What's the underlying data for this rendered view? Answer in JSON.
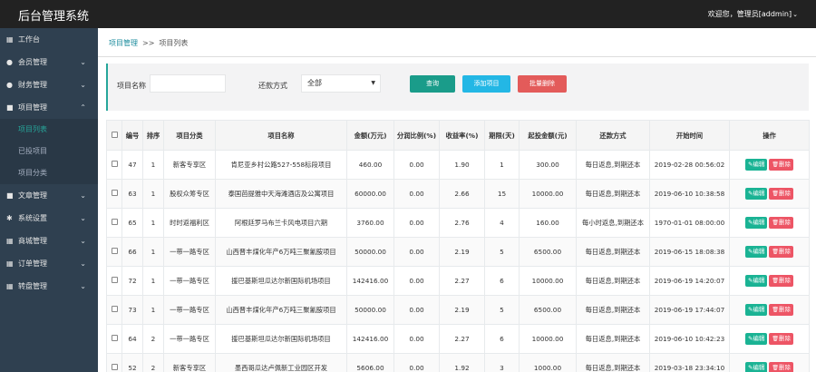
{
  "app": {
    "title": "后台管理系统",
    "user": "欢迎您，管理员[addmin]"
  },
  "sidebar": {
    "items": [
      {
        "label": "工作台",
        "icon": "grid-icon",
        "glyph": "▦",
        "chev": ""
      },
      {
        "label": "会员管理",
        "icon": "user-icon",
        "glyph": "●",
        "chev": "⌄"
      },
      {
        "label": "财务管理",
        "icon": "dollar-icon",
        "glyph": "●",
        "chev": "⌄"
      },
      {
        "label": "项目管理",
        "icon": "list-icon",
        "glyph": "■",
        "chev": "⌃"
      }
    ],
    "sub_items": [
      {
        "label": "项目列表",
        "active": true
      },
      {
        "label": "已投项目",
        "active": false
      },
      {
        "label": "项目分类",
        "active": false
      }
    ],
    "items_after": [
      {
        "label": "文章管理",
        "icon": "file-icon",
        "glyph": "■",
        "chev": "⌄"
      },
      {
        "label": "系统设置",
        "icon": "gear-icon",
        "glyph": "✱",
        "chev": "⌄"
      },
      {
        "label": "商城管理",
        "icon": "grid-icon",
        "glyph": "▦",
        "chev": "⌄"
      },
      {
        "label": "订单管理",
        "icon": "grid-icon",
        "glyph": "▦",
        "chev": "⌄"
      },
      {
        "label": "转盘管理",
        "icon": "grid-icon",
        "glyph": "▦",
        "chev": "⌄"
      }
    ]
  },
  "breadcrumb": {
    "parent": "项目管理",
    "separator": ">>",
    "current": "项目列表"
  },
  "filter": {
    "name_label": "项目名称",
    "name_value": "",
    "repay_label": "还款方式",
    "repay_value": "全部",
    "search_btn": "查询",
    "add_btn": "添加项目",
    "batch_delete_btn": "批量删除"
  },
  "table": {
    "headers": [
      "",
      "编号",
      "排序",
      "项目分类",
      "项目名称",
      "金额(万元)",
      "分润比例(%)",
      "收益率(%)",
      "期限(天)",
      "起投金额(元)",
      "还款方式",
      "开始时间",
      "操作"
    ],
    "edit_label": "编辑",
    "delete_label": "删除",
    "rows": [
      {
        "id": "47",
        "sort": "1",
        "category": "新客专享区",
        "name": "肯尼亚乡村公路527-558标段项目",
        "amount": "460.00",
        "share": "0.00",
        "rate": "1.90",
        "term": "1",
        "min": "300.00",
        "repay": "每日返息,到期还本",
        "start": "2019-02-28 00:56:02"
      },
      {
        "id": "63",
        "sort": "1",
        "category": "股权众筹专区",
        "name": "泰国芭提雅中天海滩酒店及公寓项目",
        "amount": "60000.00",
        "share": "0.00",
        "rate": "2.66",
        "term": "15",
        "min": "10000.00",
        "repay": "每日返息,到期还本",
        "start": "2019-06-10 10:38:58"
      },
      {
        "id": "65",
        "sort": "1",
        "category": "时时返福利区",
        "name": "阿根廷罗马布兰卡风电项目六期",
        "amount": "3760.00",
        "share": "0.00",
        "rate": "2.76",
        "term": "4",
        "min": "160.00",
        "repay": "每小时返息,到期还本",
        "start": "1970-01-01 08:00:00"
      },
      {
        "id": "66",
        "sort": "1",
        "category": "一带一路专区",
        "name": "山西晋丰煤化年产6万吨三聚氰胺项目",
        "amount": "50000.00",
        "share": "0.00",
        "rate": "2.19",
        "term": "5",
        "min": "6500.00",
        "repay": "每日返息,到期还本",
        "start": "2019-06-15 18:08:38"
      },
      {
        "id": "72",
        "sort": "1",
        "category": "一带一路专区",
        "name": "援巴基斯坦瓜达尔新国际机场项目",
        "amount": "142416.00",
        "share": "0.00",
        "rate": "2.27",
        "term": "6",
        "min": "10000.00",
        "repay": "每日返息,到期还本",
        "start": "2019-06-19 14:20:07"
      },
      {
        "id": "73",
        "sort": "1",
        "category": "一带一路专区",
        "name": "山西晋丰煤化年产6万吨三聚氰胺项目",
        "amount": "50000.00",
        "share": "0.00",
        "rate": "2.19",
        "term": "5",
        "min": "6500.00",
        "repay": "每日返息,到期还本",
        "start": "2019-06-19 17:44:07"
      },
      {
        "id": "64",
        "sort": "2",
        "category": "一带一路专区",
        "name": "援巴基斯坦瓜达尔新国际机场项目",
        "amount": "142416.00",
        "share": "0.00",
        "rate": "2.27",
        "term": "6",
        "min": "10000.00",
        "repay": "每日返息,到期还本",
        "start": "2019-06-10 10:42:23"
      },
      {
        "id": "52",
        "sort": "2",
        "category": "新客专享区",
        "name": "墨西哥瓜达卢佩新工业园区开发",
        "amount": "5606.00",
        "share": "0.00",
        "rate": "1.92",
        "term": "3",
        "min": "1000.00",
        "repay": "每日返息,到期还本",
        "start": "2019-03-18 23:34:10"
      }
    ]
  }
}
